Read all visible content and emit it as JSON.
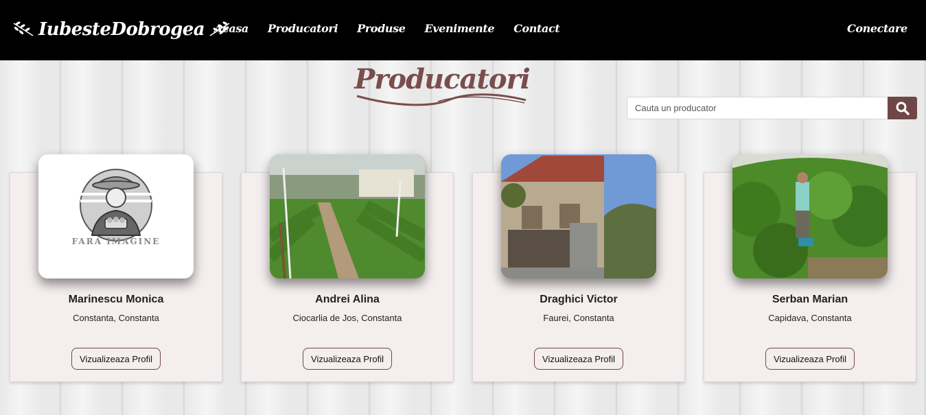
{
  "header": {
    "logo_text": "IubesteDobrogea",
    "nav": [
      "Acasa",
      "Producatori",
      "Produse",
      "Evenimente",
      "Contact"
    ],
    "login_label": "Conectare"
  },
  "page": {
    "title": "Producatori"
  },
  "search": {
    "placeholder": "Cauta un producator",
    "button_icon": "search-icon"
  },
  "placeholder_image": {
    "text": "FARA IMAGINE"
  },
  "producers": [
    {
      "name": "Marinescu Monica",
      "location": "Constanta, Constanta",
      "button": "Vizualizeaza Profil",
      "image": "no-image-placeholder"
    },
    {
      "name": "Andrei Alina",
      "location": "Ciocarlia de Jos, Constanta",
      "button": "Vizualizeaza Profil",
      "image": "greenhouse-photo"
    },
    {
      "name": "Draghici Victor",
      "location": "Faurei, Constanta",
      "button": "Vizualizeaza Profil",
      "image": "house-photo"
    },
    {
      "name": "Serban Marian",
      "location": "Capidava, Constanta",
      "button": "Vizualizeaza Profil",
      "image": "greenhouse-plants-photo"
    }
  ],
  "colors": {
    "header_bg": "#000000",
    "accent": "#6f4748",
    "title": "#7a4d4d",
    "card_bg": "#f4eeee"
  }
}
